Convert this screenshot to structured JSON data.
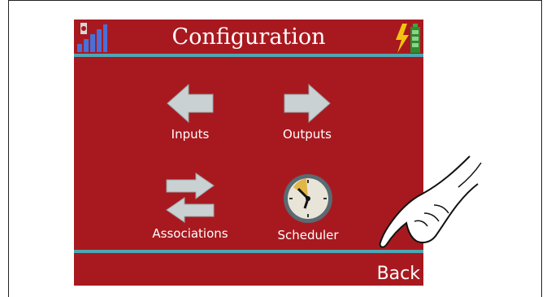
{
  "header": {
    "title": "Configuration"
  },
  "menu": [
    {
      "label": "Inputs",
      "icon": "arrow-left-icon"
    },
    {
      "label": "Outputs",
      "icon": "arrow-right-icon"
    },
    {
      "label": "Associations",
      "icon": "swap-arrows-icon"
    },
    {
      "label": "Scheduler",
      "icon": "clock-icon"
    }
  ],
  "footer": {
    "back_label": "Back"
  },
  "colors": {
    "background": "#a8191f",
    "divider": "#4fa6b3",
    "text": "#ffffff",
    "arrow": "#c9d1d3"
  }
}
